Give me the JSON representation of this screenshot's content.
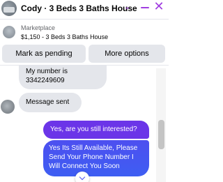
{
  "header": {
    "title": "Cody · 3 Beds 3 Baths House"
  },
  "marketplace": {
    "label": "Marketplace",
    "listing": "$1,150 - 3 Beds 3 Baths House"
  },
  "actions": {
    "pending_label": "Mark as pending",
    "more_label": "More options"
  },
  "messages": {
    "incoming": [
      {
        "text": "My number is 3342249609"
      },
      {
        "text": "Message sent"
      }
    ],
    "outgoing": [
      {
        "text": "Yes, are you still interested?"
      },
      {
        "text": "Yes Its Still Available, Please Send Your Phone Number I Will Connect You Soon"
      }
    ]
  },
  "colors": {
    "accent": "#a03ce0",
    "outgoing_bubble": "#6b35e8",
    "outgoing_bubble_alt": "#4d4ff0",
    "incoming_bubble": "#e4e6eb"
  },
  "icons": {
    "chevron": "chevron-down-icon",
    "minimize": "minimize-icon",
    "close": "close-icon",
    "scroll_down": "arrow-down-icon"
  }
}
